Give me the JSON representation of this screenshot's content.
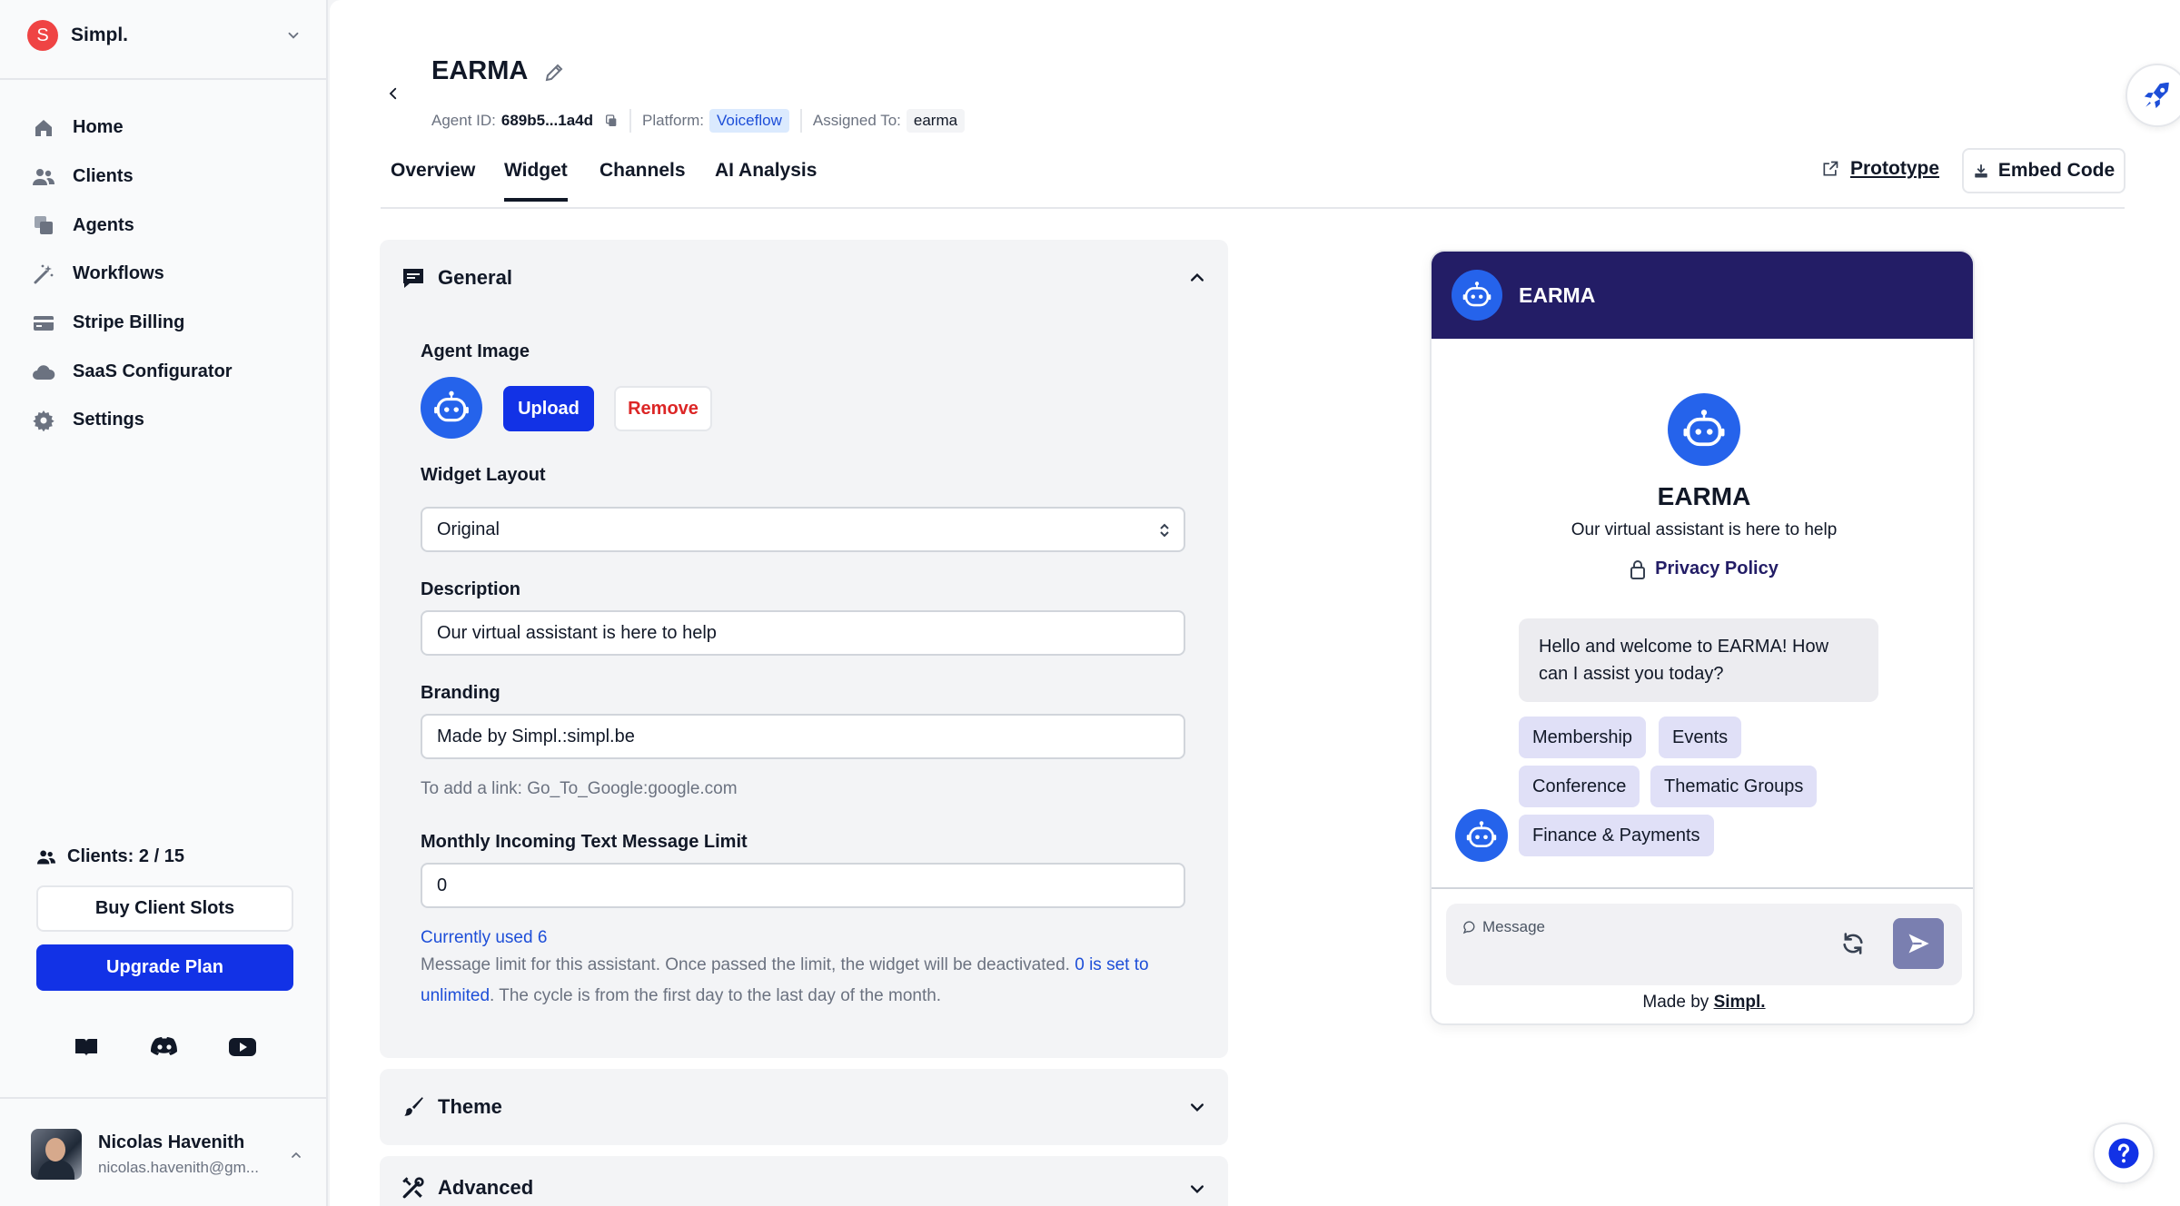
{
  "workspace": {
    "initial": "S",
    "name": "Simpl."
  },
  "sidebar": {
    "items": [
      {
        "label": "Home",
        "icon": "home-icon"
      },
      {
        "label": "Clients",
        "icon": "users-icon"
      },
      {
        "label": "Agents",
        "icon": "agents-icon"
      },
      {
        "label": "Workflows",
        "icon": "wand-icon"
      },
      {
        "label": "Stripe Billing",
        "icon": "credit-card-icon"
      },
      {
        "label": "SaaS Configurator",
        "icon": "cloud-icon"
      },
      {
        "label": "Settings",
        "icon": "gear-icon"
      }
    ],
    "clients_count": "Clients: 2 / 15",
    "buy_slots": "Buy Client Slots",
    "upgrade": "Upgrade Plan",
    "socials": [
      "book-icon",
      "discord-icon",
      "youtube-icon"
    ]
  },
  "user": {
    "name": "Nicolas Havenith",
    "email": "nicolas.havenith@gm..."
  },
  "agent": {
    "title": "EARMA",
    "id_label": "Agent ID:",
    "id_value": "689b5...1a4d",
    "platform_label": "Platform:",
    "platform_value": "Voiceflow",
    "assigned_label": "Assigned To:",
    "assigned_value": "earma"
  },
  "tabs": [
    "Overview",
    "Widget",
    "Channels",
    "AI Analysis"
  ],
  "active_tab": "Widget",
  "actions": {
    "prototype": "Prototype",
    "embed": "Embed Code"
  },
  "general": {
    "title": "General",
    "agent_image_label": "Agent Image",
    "upload": "Upload",
    "remove": "Remove",
    "layout_label": "Widget Layout",
    "layout_value": "Original",
    "description_label": "Description",
    "description_value": "Our virtual assistant is here to help",
    "branding_label": "Branding",
    "branding_value": "Made by Simpl.:simpl.be",
    "branding_hint": "To add a link: Go_To_Google:google.com",
    "limit_label": "Monthly Incoming Text Message Limit",
    "limit_value": "0",
    "currently_used": "Currently used 6",
    "note_part1": "Message limit for this assistant. Once passed the limit, the widget will be deactivated. ",
    "note_link": "0 is set to unlimited",
    "note_part2": ". The cycle is from the first day to the last day of the month."
  },
  "sections": {
    "theme": "Theme",
    "advanced": "Advanced"
  },
  "preview": {
    "header_title": "EARMA",
    "name": "EARMA",
    "description": "Our virtual assistant is here to help",
    "privacy": "Privacy Policy",
    "welcome": "Hello and welcome to EARMA! How can I assist you today?",
    "chips": [
      "Membership",
      "Events",
      "Conference",
      "Thematic Groups",
      "Finance & Payments"
    ],
    "placeholder": "Message",
    "made_by": "Made by ",
    "made_by_link": "Simpl.",
    "header_color": "#231d66",
    "accent": "#2563eb"
  }
}
